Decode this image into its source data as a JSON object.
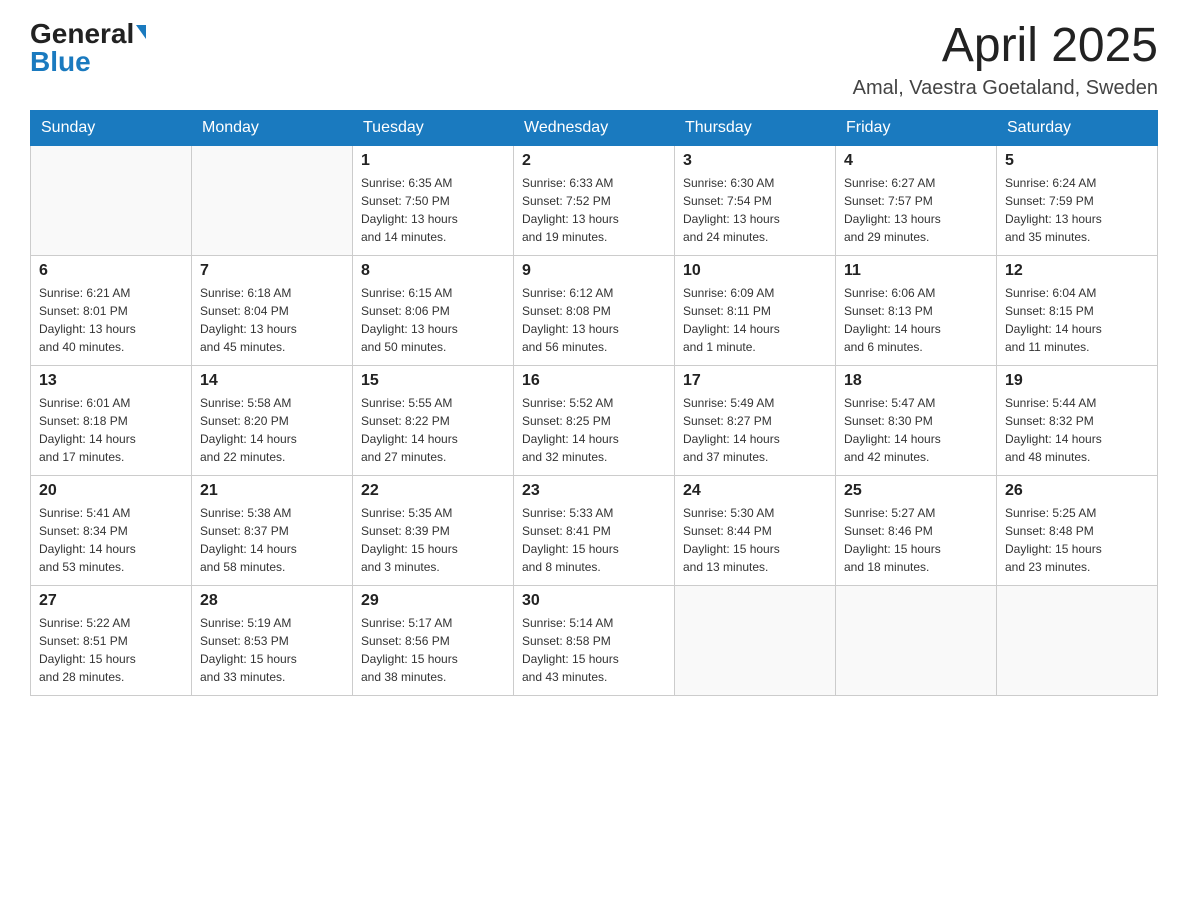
{
  "header": {
    "logo_general": "General",
    "logo_blue": "Blue",
    "month_year": "April 2025",
    "location": "Amal, Vaestra Goetaland, Sweden"
  },
  "days_of_week": [
    "Sunday",
    "Monday",
    "Tuesday",
    "Wednesday",
    "Thursday",
    "Friday",
    "Saturday"
  ],
  "weeks": [
    [
      {
        "day": "",
        "info": ""
      },
      {
        "day": "",
        "info": ""
      },
      {
        "day": "1",
        "info": "Sunrise: 6:35 AM\nSunset: 7:50 PM\nDaylight: 13 hours\nand 14 minutes."
      },
      {
        "day": "2",
        "info": "Sunrise: 6:33 AM\nSunset: 7:52 PM\nDaylight: 13 hours\nand 19 minutes."
      },
      {
        "day": "3",
        "info": "Sunrise: 6:30 AM\nSunset: 7:54 PM\nDaylight: 13 hours\nand 24 minutes."
      },
      {
        "day": "4",
        "info": "Sunrise: 6:27 AM\nSunset: 7:57 PM\nDaylight: 13 hours\nand 29 minutes."
      },
      {
        "day": "5",
        "info": "Sunrise: 6:24 AM\nSunset: 7:59 PM\nDaylight: 13 hours\nand 35 minutes."
      }
    ],
    [
      {
        "day": "6",
        "info": "Sunrise: 6:21 AM\nSunset: 8:01 PM\nDaylight: 13 hours\nand 40 minutes."
      },
      {
        "day": "7",
        "info": "Sunrise: 6:18 AM\nSunset: 8:04 PM\nDaylight: 13 hours\nand 45 minutes."
      },
      {
        "day": "8",
        "info": "Sunrise: 6:15 AM\nSunset: 8:06 PM\nDaylight: 13 hours\nand 50 minutes."
      },
      {
        "day": "9",
        "info": "Sunrise: 6:12 AM\nSunset: 8:08 PM\nDaylight: 13 hours\nand 56 minutes."
      },
      {
        "day": "10",
        "info": "Sunrise: 6:09 AM\nSunset: 8:11 PM\nDaylight: 14 hours\nand 1 minute."
      },
      {
        "day": "11",
        "info": "Sunrise: 6:06 AM\nSunset: 8:13 PM\nDaylight: 14 hours\nand 6 minutes."
      },
      {
        "day": "12",
        "info": "Sunrise: 6:04 AM\nSunset: 8:15 PM\nDaylight: 14 hours\nand 11 minutes."
      }
    ],
    [
      {
        "day": "13",
        "info": "Sunrise: 6:01 AM\nSunset: 8:18 PM\nDaylight: 14 hours\nand 17 minutes."
      },
      {
        "day": "14",
        "info": "Sunrise: 5:58 AM\nSunset: 8:20 PM\nDaylight: 14 hours\nand 22 minutes."
      },
      {
        "day": "15",
        "info": "Sunrise: 5:55 AM\nSunset: 8:22 PM\nDaylight: 14 hours\nand 27 minutes."
      },
      {
        "day": "16",
        "info": "Sunrise: 5:52 AM\nSunset: 8:25 PM\nDaylight: 14 hours\nand 32 minutes."
      },
      {
        "day": "17",
        "info": "Sunrise: 5:49 AM\nSunset: 8:27 PM\nDaylight: 14 hours\nand 37 minutes."
      },
      {
        "day": "18",
        "info": "Sunrise: 5:47 AM\nSunset: 8:30 PM\nDaylight: 14 hours\nand 42 minutes."
      },
      {
        "day": "19",
        "info": "Sunrise: 5:44 AM\nSunset: 8:32 PM\nDaylight: 14 hours\nand 48 minutes."
      }
    ],
    [
      {
        "day": "20",
        "info": "Sunrise: 5:41 AM\nSunset: 8:34 PM\nDaylight: 14 hours\nand 53 minutes."
      },
      {
        "day": "21",
        "info": "Sunrise: 5:38 AM\nSunset: 8:37 PM\nDaylight: 14 hours\nand 58 minutes."
      },
      {
        "day": "22",
        "info": "Sunrise: 5:35 AM\nSunset: 8:39 PM\nDaylight: 15 hours\nand 3 minutes."
      },
      {
        "day": "23",
        "info": "Sunrise: 5:33 AM\nSunset: 8:41 PM\nDaylight: 15 hours\nand 8 minutes."
      },
      {
        "day": "24",
        "info": "Sunrise: 5:30 AM\nSunset: 8:44 PM\nDaylight: 15 hours\nand 13 minutes."
      },
      {
        "day": "25",
        "info": "Sunrise: 5:27 AM\nSunset: 8:46 PM\nDaylight: 15 hours\nand 18 minutes."
      },
      {
        "day": "26",
        "info": "Sunrise: 5:25 AM\nSunset: 8:48 PM\nDaylight: 15 hours\nand 23 minutes."
      }
    ],
    [
      {
        "day": "27",
        "info": "Sunrise: 5:22 AM\nSunset: 8:51 PM\nDaylight: 15 hours\nand 28 minutes."
      },
      {
        "day": "28",
        "info": "Sunrise: 5:19 AM\nSunset: 8:53 PM\nDaylight: 15 hours\nand 33 minutes."
      },
      {
        "day": "29",
        "info": "Sunrise: 5:17 AM\nSunset: 8:56 PM\nDaylight: 15 hours\nand 38 minutes."
      },
      {
        "day": "30",
        "info": "Sunrise: 5:14 AM\nSunset: 8:58 PM\nDaylight: 15 hours\nand 43 minutes."
      },
      {
        "day": "",
        "info": ""
      },
      {
        "day": "",
        "info": ""
      },
      {
        "day": "",
        "info": ""
      }
    ]
  ]
}
